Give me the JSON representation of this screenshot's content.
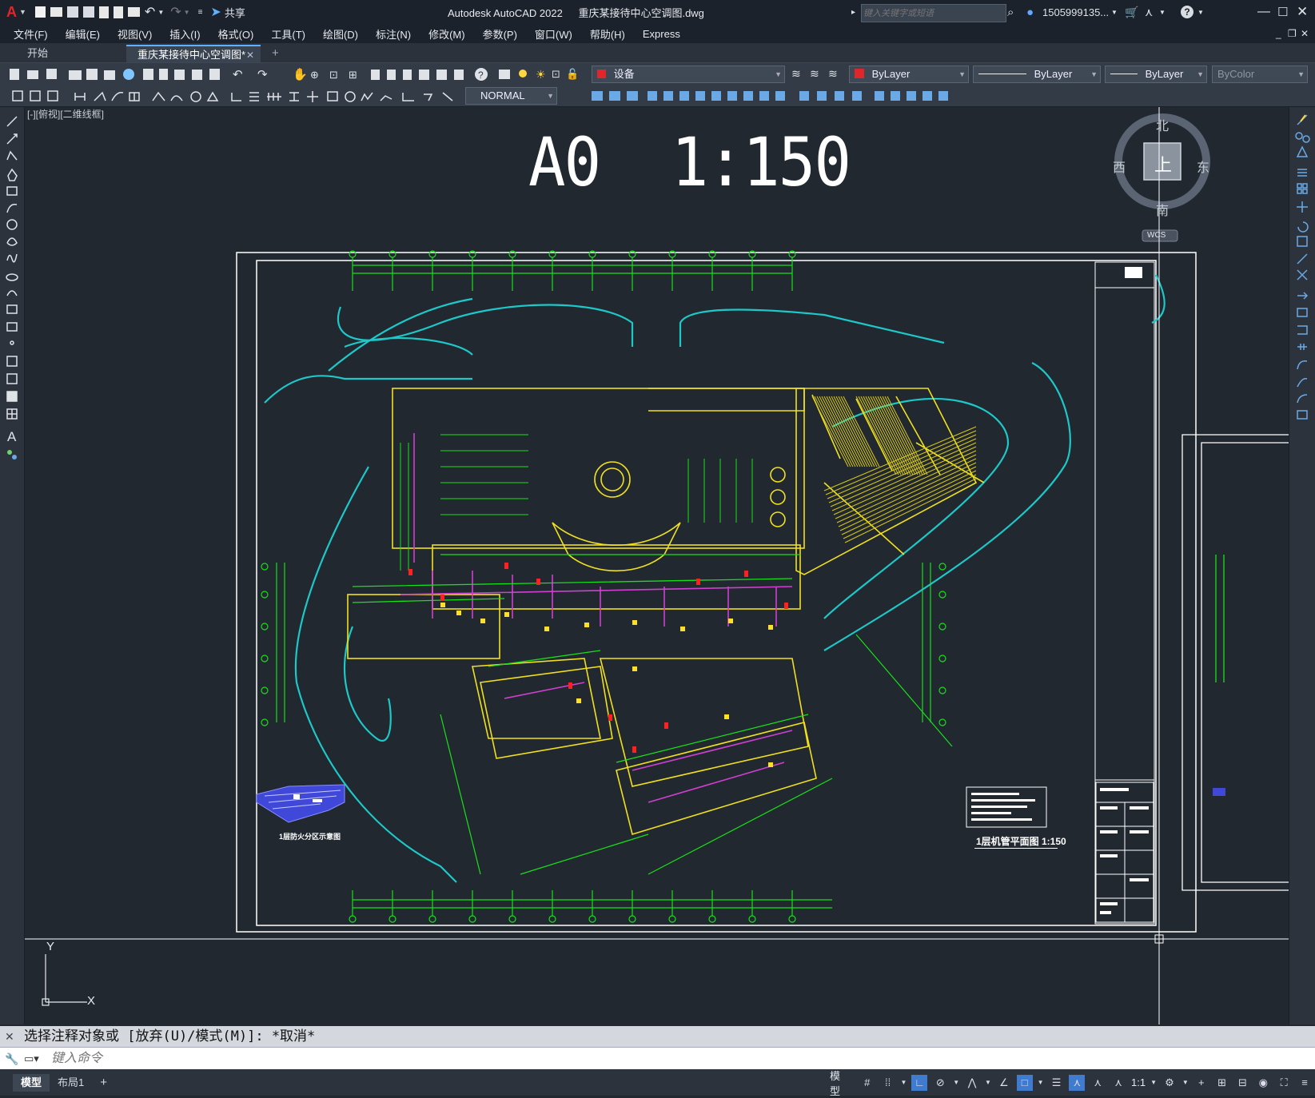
{
  "app": {
    "title": "Autodesk AutoCAD 2022",
    "filename": "重庆某接待中心空调图.dwg",
    "share_label": "共享",
    "search_placeholder": "键入关键字或短语",
    "user": "1505999135...",
    "accent_color": "#e0262a"
  },
  "menu": [
    "文件(F)",
    "编辑(E)",
    "视图(V)",
    "插入(I)",
    "格式(O)",
    "工具(T)",
    "绘图(D)",
    "标注(N)",
    "修改(M)",
    "参数(P)",
    "窗口(W)",
    "帮助(H)",
    "Express"
  ],
  "tabs": [
    {
      "label": "开始",
      "active": false
    },
    {
      "label": "重庆某接待中心空调图*",
      "active": true
    }
  ],
  "properties": {
    "layer": "设备",
    "color": "ByLayer",
    "linetype": "ByLayer",
    "lineweight": "ByLayer",
    "plotstyle": "ByColor",
    "dimstyle": "NORMAL"
  },
  "viewport_label": "[-][俯视][二维线框]",
  "drawing": {
    "big_title": "A0  1:150",
    "sheet_title": "1层机管平面图  1:150",
    "inset_caption": "1层防火分区示意图",
    "colors": {
      "grid": "#18e018",
      "road": "#1ec8c8",
      "wall": "#f0e020",
      "duct": "#d040d0",
      "text": "#ffffff",
      "accent": "#ff2020"
    }
  },
  "viewcube": {
    "north": "北",
    "south": "南",
    "east": "东",
    "west": "西",
    "top": "上",
    "wcs": "WCS"
  },
  "ucs": {
    "x": "X",
    "y": "Y"
  },
  "command": {
    "history": "选择注释对象或 [放弃(U)/模式(M)]: *取消*",
    "placeholder": "键入命令"
  },
  "layouts": [
    "模型",
    "布局1"
  ],
  "status": {
    "model": "模型",
    "scale": "1:1"
  }
}
